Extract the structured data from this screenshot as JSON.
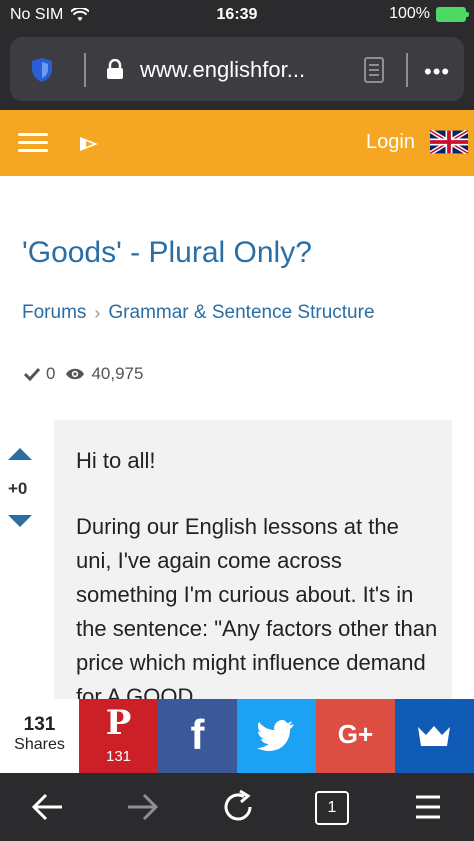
{
  "status_bar": {
    "carrier": "No SIM",
    "time": "16:39",
    "battery": "100%"
  },
  "browser": {
    "url": "www.englishfor..."
  },
  "site_header": {
    "login_label": "Login"
  },
  "content": {
    "title": "'Goods' - Plural Only?",
    "breadcrumb": [
      "Forums",
      "Grammar & Sentence Structure"
    ],
    "likes": "0",
    "views": "40,975"
  },
  "vote": {
    "count": "+0"
  },
  "post": {
    "greeting": "Hi to all!",
    "body": "During our English lessons at the uni, I've again come across something I'm curious about. It's in the sentence: \"Any factors other than price which might influence demand for A GOOD"
  },
  "share": {
    "total": "131",
    "label": "Shares",
    "pinterest_count": "131",
    "buttons": [
      "pinterest",
      "facebook",
      "twitter",
      "google-plus",
      "sumo-crown"
    ]
  },
  "toolbar": {
    "tab_count": "1"
  },
  "colors": {
    "header": "#f5a623",
    "link": "#2a6ea6",
    "chrome": "#2b2b2e",
    "pinterest": "#cb2027",
    "facebook": "#3b5998",
    "twitter": "#1da1f2",
    "google_plus": "#dc4e41",
    "crown": "#105bb5"
  }
}
